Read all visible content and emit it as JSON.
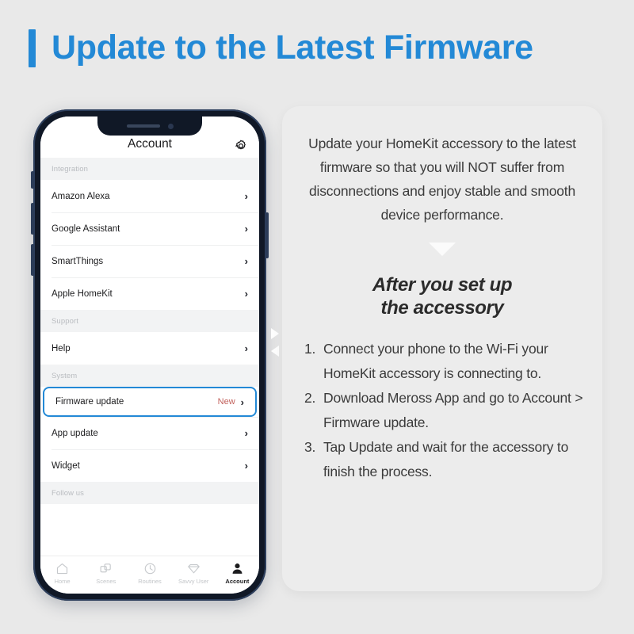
{
  "header": {
    "title": "Update to the Latest Firmware",
    "accent_color": "#2389d6"
  },
  "phone": {
    "navbar": {
      "title": "Account",
      "settings_icon": "gear-icon"
    },
    "sections": [
      {
        "header": "Integration",
        "rows": [
          {
            "label": "Amazon Alexa",
            "badge": "",
            "chevron": "›",
            "highlighted": false
          },
          {
            "label": "Google Assistant",
            "badge": "",
            "chevron": "›",
            "highlighted": false
          },
          {
            "label": "SmartThings",
            "badge": "",
            "chevron": "›",
            "highlighted": false
          },
          {
            "label": "Apple HomeKit",
            "badge": "",
            "chevron": "›",
            "highlighted": false
          }
        ]
      },
      {
        "header": "Support",
        "rows": [
          {
            "label": "Help",
            "badge": "",
            "chevron": "›",
            "highlighted": false
          }
        ]
      },
      {
        "header": "System",
        "rows": [
          {
            "label": "Firmware update",
            "badge": "New",
            "chevron": "›",
            "highlighted": true
          },
          {
            "label": "App update",
            "badge": "",
            "chevron": "›",
            "highlighted": false
          },
          {
            "label": "Widget",
            "badge": "",
            "chevron": "›",
            "highlighted": false
          }
        ]
      },
      {
        "header": "Follow us",
        "rows": []
      }
    ],
    "badge_color": "#c2615c",
    "highlight_color": "#2389d6",
    "tabbar": [
      {
        "label": "Home",
        "icon": "home-icon",
        "active": false
      },
      {
        "label": "Scenes",
        "icon": "scenes-icon",
        "active": false
      },
      {
        "label": "Routines",
        "icon": "clock-icon",
        "active": false
      },
      {
        "label": "Savvy User",
        "icon": "diamond-icon",
        "active": false
      },
      {
        "label": "Account",
        "icon": "person-icon",
        "active": true
      }
    ]
  },
  "card": {
    "intro": "Update your HomeKit accessory to the latest firmware so that you will NOT suffer from disconnections and enjoy stable and smooth device performance.",
    "divider_icon": "triangle-down-icon",
    "sub_heading_line1": "After you set up",
    "sub_heading_line2": "the accessory",
    "steps": [
      {
        "num": "1.",
        "text": "Connect your phone to the Wi-Fi your HomeKit accessory is connecting to."
      },
      {
        "num": "2.",
        "text": "Download Meross  App and go to Account > Firmware update."
      },
      {
        "num": "3.",
        "text": "Tap Update and wait for the accessory to finish the process."
      }
    ]
  }
}
